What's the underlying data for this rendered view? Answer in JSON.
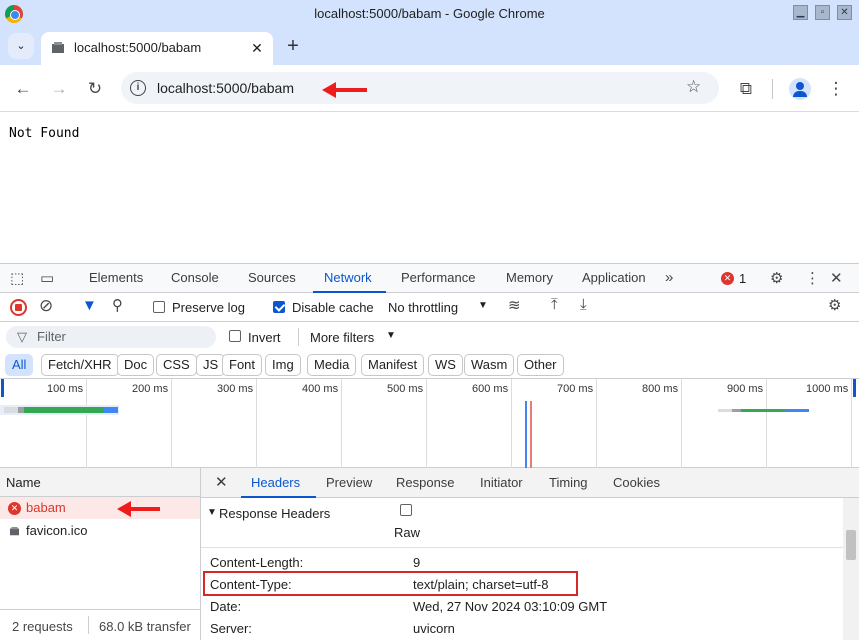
{
  "window": {
    "title": "localhost:5000/babam - Google Chrome"
  },
  "tab": {
    "title": "localhost:5000/babam",
    "close": "✕",
    "new_tab": "+"
  },
  "toolbar": {
    "url": "localhost:5000/babam"
  },
  "page": {
    "body_text": "Not Found"
  },
  "devtools": {
    "tabs": [
      "Elements",
      "Console",
      "Sources",
      "Network",
      "Performance",
      "Memory",
      "Application"
    ],
    "more_tabs": "»",
    "error_count": "1",
    "toolbar": {
      "preserve_log": "Preserve log",
      "disable_cache": "Disable cache",
      "throttling": "No throttling"
    },
    "filter": {
      "placeholder": "Filter",
      "invert": "Invert",
      "more_filters": "More filters"
    },
    "type_filters": [
      "All",
      "Fetch/XHR",
      "Doc",
      "CSS",
      "JS",
      "Font",
      "Img",
      "Media",
      "Manifest",
      "WS",
      "Wasm",
      "Other"
    ],
    "timeline_ticks": [
      "100 ms",
      "200 ms",
      "300 ms",
      "400 ms",
      "500 ms",
      "600 ms",
      "700 ms",
      "800 ms",
      "900 ms",
      "1000 ms"
    ],
    "requests": {
      "column_name": "Name",
      "items": [
        {
          "name": "babam",
          "status": "error"
        },
        {
          "name": "favicon.ico",
          "status": "ok"
        }
      ],
      "summary_count": "2 requests",
      "summary_transfer": "68.0 kB transfer"
    },
    "detail": {
      "tabs": [
        "Headers",
        "Preview",
        "Response",
        "Initiator",
        "Timing",
        "Cookies"
      ],
      "section_title": "Response Headers",
      "raw_label": "Raw",
      "headers": [
        {
          "key": "Content-Length:",
          "value": "9"
        },
        {
          "key": "Content-Type:",
          "value": "text/plain; charset=utf-8"
        },
        {
          "key": "Date:",
          "value": "Wed, 27 Nov 2024 03:10:09 GMT"
        },
        {
          "key": "Server:",
          "value": "uvicorn"
        }
      ]
    }
  },
  "colors": {
    "accent": "#0b57d0",
    "error": "#dc362e",
    "annotation": "#ee1c1c"
  }
}
